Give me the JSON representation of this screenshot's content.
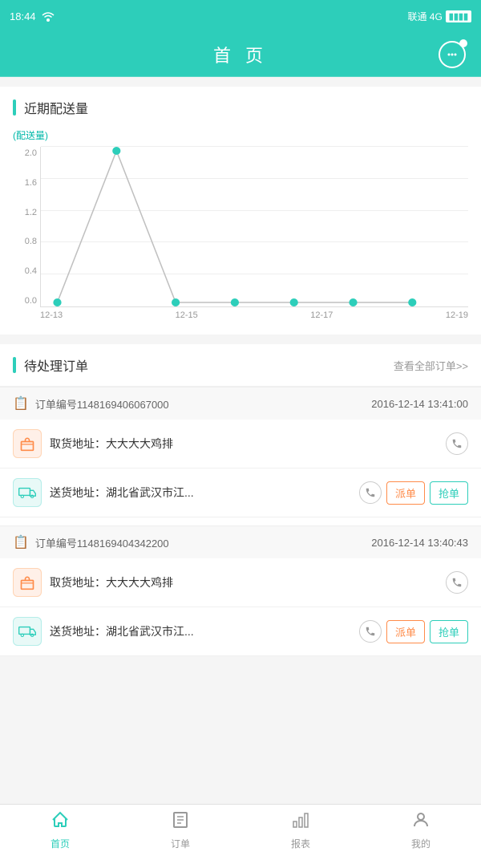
{
  "statusBar": {
    "time": "18:44",
    "carrier": "联通 4G"
  },
  "header": {
    "title": "首 页"
  },
  "chart": {
    "yAxisLabel": "(配送量)",
    "yTicks": [
      "0.0",
      "0.4",
      "0.8",
      "1.2",
      "1.6",
      "2.0"
    ],
    "xLabels": [
      "12-13",
      "12-15",
      "12-17",
      "12-19"
    ],
    "sectionTitle": "近期配送量"
  },
  "orders": {
    "sectionTitle": "待处理订单",
    "viewAll": "查看全部订单>>",
    "items": [
      {
        "id": "订单编号1148169406067000",
        "time": "2016-12-14 13:41:00",
        "pickup": "取货地址：大大大大鸡排",
        "delivery": "送货地址：湖北省武汉市江...",
        "hasActions": true
      },
      {
        "id": "订单编号1148169404342200",
        "time": "2016-12-14 13:40:43",
        "pickup": "取货地址：大大大大鸡排",
        "delivery": "送货地址：湖北省武汉市江...",
        "hasActions": true
      }
    ],
    "btnPai": "派单",
    "btnQiang": "抢单"
  },
  "bottomNav": {
    "items": [
      {
        "label": "首页",
        "active": true
      },
      {
        "label": "订单",
        "active": false
      },
      {
        "label": "报表",
        "active": false
      },
      {
        "label": "我的",
        "active": false
      }
    ]
  }
}
